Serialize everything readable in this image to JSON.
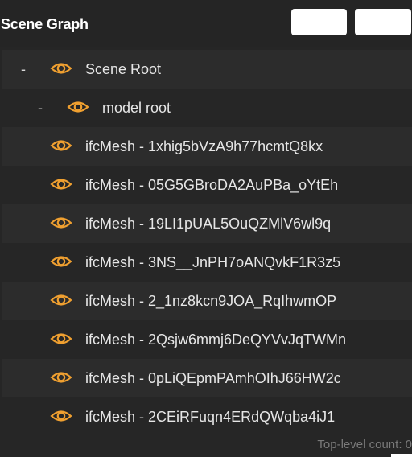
{
  "header": {
    "title": "Scene Graph"
  },
  "tree": {
    "scene_root": {
      "toggle": "-",
      "label": "Scene Root",
      "icon": "eye-icon"
    },
    "model_root": {
      "toggle": "-",
      "label": "model root",
      "icon": "eye-icon"
    },
    "meshes": [
      {
        "label": "ifcMesh - 1xhig5bVzA9h77hcmtQ8kx",
        "icon": "eye-icon"
      },
      {
        "label": "ifcMesh - 05G5GBroDA2AuPBa_oYtEh",
        "icon": "eye-icon"
      },
      {
        "label": "ifcMesh - 19LI1pUAL5OuQZMlV6wl9q",
        "icon": "eye-icon"
      },
      {
        "label": "ifcMesh - 3NS__JnPH7oANQvkF1R3z5",
        "icon": "eye-icon"
      },
      {
        "label": "ifcMesh - 2_1nz8kcn9JOA_RqIhwmOP",
        "icon": "eye-icon"
      },
      {
        "label": "ifcMesh - 2Qsjw6mmj6DeQYVvJqTWMn",
        "icon": "eye-icon"
      },
      {
        "label": "ifcMesh - 0pLiQEpmPAmhOIhJ66HW2c",
        "icon": "eye-icon"
      },
      {
        "label": "ifcMesh - 2CEiRFuqn4ERdQWqba4iJ1",
        "icon": "eye-icon"
      }
    ]
  },
  "footer": {
    "count_text": "Top-level count: 0"
  },
  "colors": {
    "background": "#262626",
    "row_alt": "#2c2c2c",
    "eye_accent": "#f0a030",
    "text": "#e6e6e6",
    "footer_text": "#7a7a7a"
  }
}
